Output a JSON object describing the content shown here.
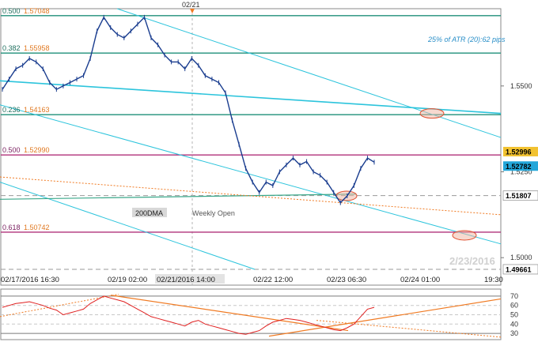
{
  "chart_data": {
    "type": "line",
    "price": {
      "series_name": "",
      "values": [
        1.549,
        1.552,
        1.555,
        1.556,
        1.558,
        1.557,
        1.555,
        1.551,
        1.549,
        1.55,
        1.551,
        1.552,
        1.553,
        1.558,
        1.566,
        1.57,
        1.567,
        1.565,
        1.564,
        1.566,
        1.568,
        1.57,
        1.564,
        1.562,
        1.559,
        1.557,
        1.557,
        1.555,
        1.558,
        1.556,
        1.553,
        1.552,
        1.551,
        1.548,
        1.54,
        1.533,
        1.526,
        1.522,
        1.519,
        1.522,
        1.521,
        1.525,
        1.527,
        1.529,
        1.527,
        1.528,
        1.525,
        1.524,
        1.522,
        1.519,
        1.516,
        1.518,
        1.521,
        1.526,
        1.529,
        1.5278
      ],
      "ylim": [
        1.4966,
        1.5725
      ],
      "y_ticks": [
        "1.5000",
        "1.5250",
        "1.5500"
      ]
    },
    "x_tick_labels": [
      "02/17/2016 16:30",
      "02/19 02:00",
      "02/21/2016 14:00",
      "02/22 12:00",
      "02/23 06:30",
      "02/24 01:00",
      "19:30"
    ],
    "top_marker_label": "02/21",
    "fib_levels": [
      {
        "ratio": "0.500",
        "value": "1.57048",
        "color": "#1f8f7a"
      },
      {
        "ratio": "0.382",
        "value": "1.55958",
        "color": "#1f8f7a"
      },
      {
        "ratio": "0.236",
        "value": "1.54163",
        "color": "#1f8f7a"
      },
      {
        "ratio": "0.500",
        "value": "1.52990",
        "color": "#b0307a"
      },
      {
        "ratio": "0.618",
        "value": "1.50742",
        "color": "#b0307a"
      }
    ],
    "right_labels": [
      {
        "text": "1.52996",
        "bg": "#f2c230",
        "fg": "#000000"
      },
      {
        "text": "1.52782",
        "bg": "#22a6d9",
        "fg": "#000000"
      },
      {
        "text": "1.51807",
        "bg": "#ffffff",
        "fg": "#000000"
      },
      {
        "text": "1.49661",
        "bg": "#ffffff",
        "fg": "#000000"
      }
    ],
    "annotations": {
      "atr": "25% of ATR (20):62 pips",
      "dma": "200DMA",
      "weekly_open": "Weekly Open",
      "watermark": "2/23/2016"
    },
    "rsi": {
      "values": [
        58,
        60,
        62,
        63,
        64,
        62,
        60,
        57,
        55,
        50,
        52,
        54,
        56,
        62,
        66,
        70,
        68,
        66,
        64,
        60,
        56,
        52,
        48,
        46,
        44,
        42,
        40,
        38,
        42,
        44,
        40,
        38,
        36,
        34,
        32,
        30,
        29,
        31,
        33,
        38,
        42,
        44,
        46,
        45,
        44,
        42,
        40,
        38,
        36,
        34,
        33,
        36,
        40,
        48,
        56,
        58
      ],
      "ylim": [
        25,
        75
      ],
      "levels": [
        "70",
        "60",
        "50",
        "40",
        "30"
      ]
    },
    "colors": {
      "price_line": "#1a3d8f",
      "channel": "#2cc4dc",
      "trend_orange": "#f07a22",
      "rsi_line": "#e02020",
      "fib_green": "#1f8f7a",
      "fib_magenta": "#b0307a"
    }
  }
}
